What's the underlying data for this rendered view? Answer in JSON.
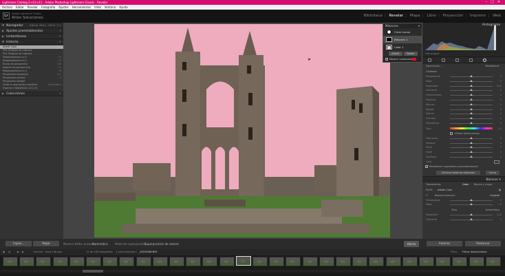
{
  "window": {
    "title": "Lightroom Catalog-2-v12-v11 - Adobe Photoshop Lightroom Classic - Revelar",
    "controls": [
      "–",
      "□",
      "✕"
    ]
  },
  "menubar": [
    "Archivo",
    "Editar",
    "Revelar",
    "Fotografía",
    "Ajustes",
    "Herramientas",
    "Vista",
    "Ventana",
    "Ayuda"
  ],
  "identity": {
    "logo": "Lr",
    "line1": "Adobe Lightroom Classic",
    "line2": "Arlen Soluciones"
  },
  "modules": [
    "Biblioteca",
    "Revelar",
    "Mapa",
    "Libro",
    "Proyección",
    "Imprimir",
    "Web"
  ],
  "active_module": "Revelar",
  "left": {
    "navigator": {
      "title": "Navegador",
      "tabs": [
        "ENCAJ",
        "RELL",
        "100%",
        "2:1"
      ]
    },
    "presets_title": "Ajustes preestablecidos",
    "snapshots_title": "Instantáneos",
    "history_title": "Historia",
    "history": [
      {
        "label": "Añadir Color",
        "value": ""
      },
      {
        "label": "Pint. Elegidos de máscara",
        "value": ""
      },
      {
        "label": "Pint. Elegidos de máscara",
        "value": ""
      },
      {
        "label": "Desplazamiento en Y",
        "value": "+9"
      },
      {
        "label": "Desplazamiento en Y",
        "value": "+9"
      },
      {
        "label": "Escala de perspectiva",
        "value": "100"
      },
      {
        "label": "Aspecto de perspec.tiva",
        "value": "+1"
      },
      {
        "label": "Desplazamiento en X",
        "value": "+6"
      },
      {
        "label": "Perspectiva horizontal",
        "value": "+11"
      },
      {
        "label": "Perspectiva vertical",
        "value": "-4"
      },
      {
        "label": "Perspectiva Upright",
        "value": ""
      },
      {
        "label": "Quitar la aberración cromática",
        "value": "Automático"
      },
      {
        "label": "Importar (30/04/2020 4:51:19)",
        "value": ""
      }
    ],
    "collections_title": "Colecciones",
    "copy_label": "Copiar...",
    "paste_label": "Pegar"
  },
  "masks": {
    "title": "Máscaras",
    "create_label": "Crear nueva máscara",
    "mask1_label": "Máscara 1",
    "color1_label": "Color 1",
    "add_label": "Añadir",
    "subtract_label": "Restar",
    "overlay_label": "Mostrar superposición",
    "overlay_checked": true,
    "overlay_color": "#e0102a"
  },
  "toolbar": {
    "crop_label": "Mostrar Editar pulsado",
    "auto_label": "Automático",
    "mode_label": "Modo de superposición",
    "overlay_value": "Superposición de colores",
    "done_label": "Hecho"
  },
  "right": {
    "histogram_title": "Histograma",
    "histogram_info": "Foto original",
    "preset_label": "Seleccionar ...",
    "preset_value": "Restablecer",
    "amount_label": "Cantidad",
    "amount_value": "",
    "sliders": [
      {
        "label": "Temperatura",
        "value": "0",
        "pos": 0.5
      },
      {
        "label": "Matiz",
        "value": "0",
        "pos": 0.5
      },
      {
        "label": "Exposición",
        "value": "0,00",
        "pos": 0.5
      },
      {
        "label": "Contraste",
        "value": "0",
        "pos": 0.5
      },
      {
        "label": "Iluminaciones",
        "value": "0",
        "pos": 0.5
      },
      {
        "label": "Sombras",
        "value": "0",
        "pos": 0.5
      },
      {
        "label": "Blancos",
        "value": "0",
        "pos": 0.5
      },
      {
        "label": "Negros",
        "value": "0",
        "pos": 0.5
      },
      {
        "label": "Textura",
        "value": "0",
        "pos": 0.5
      },
      {
        "label": "Claridad",
        "value": "0",
        "pos": 0.5
      },
      {
        "label": "Desneblinar",
        "value": "0",
        "pos": 0.5
      }
    ],
    "hue_label": "Tono",
    "hue_value": "0,0",
    "fine_label": "Utilizar Ajuste preciso",
    "saturation_label": "Saturación",
    "saturation_value": "0",
    "sliders2": [
      {
        "label": "Enfoque",
        "value": "0",
        "pos": 0.5
      },
      {
        "label": "Ruido",
        "value": "0",
        "pos": 0.5
      },
      {
        "label": "Moiré",
        "value": "0",
        "pos": 0.5
      },
      {
        "label": "Desflecar",
        "value": "0",
        "pos": 0.5
      }
    ],
    "color_label": "Color",
    "auto_reset_label": "Restablecer reguladores automáticamente",
    "delete_all_label": "Eliminar todas las máscaras",
    "close_label": "Cerrar",
    "basic_title": "Básicos",
    "treatment_label": "Tratamiento:",
    "treatment_color": "Color",
    "treatment_bw": "Blanco y negro",
    "profile_label": "Perfil:",
    "profile_value": "Adobe Color",
    "wb_label": "Balance blancos:",
    "wb_value": "Original",
    "sliders3": [
      {
        "label": "Temperatura",
        "value": "0",
        "pos": 0.55
      },
      {
        "label": "Matiz",
        "value": "+ 8",
        "pos": 0.58
      }
    ],
    "tone_label": "Tono",
    "tone_auto": "Automático",
    "sliders4": [
      {
        "label": "Exposición",
        "value": "0,00",
        "pos": 0.5
      },
      {
        "label": "Contraste",
        "value": "0",
        "pos": 0.5
      }
    ],
    "prev_label": "Anterior",
    "reset_label": "Restaurar"
  },
  "filmbar": {
    "left": "General - Usos a Brujas",
    "count": "31 de 208 fotografías",
    "sel": "1 seleccionadas /",
    "file": "_DSC6348.NEF",
    "filter_label": "Filtro:",
    "filter_value": "Filtros desactivados"
  },
  "thumbs": 30,
  "thumb_selected": 14
}
